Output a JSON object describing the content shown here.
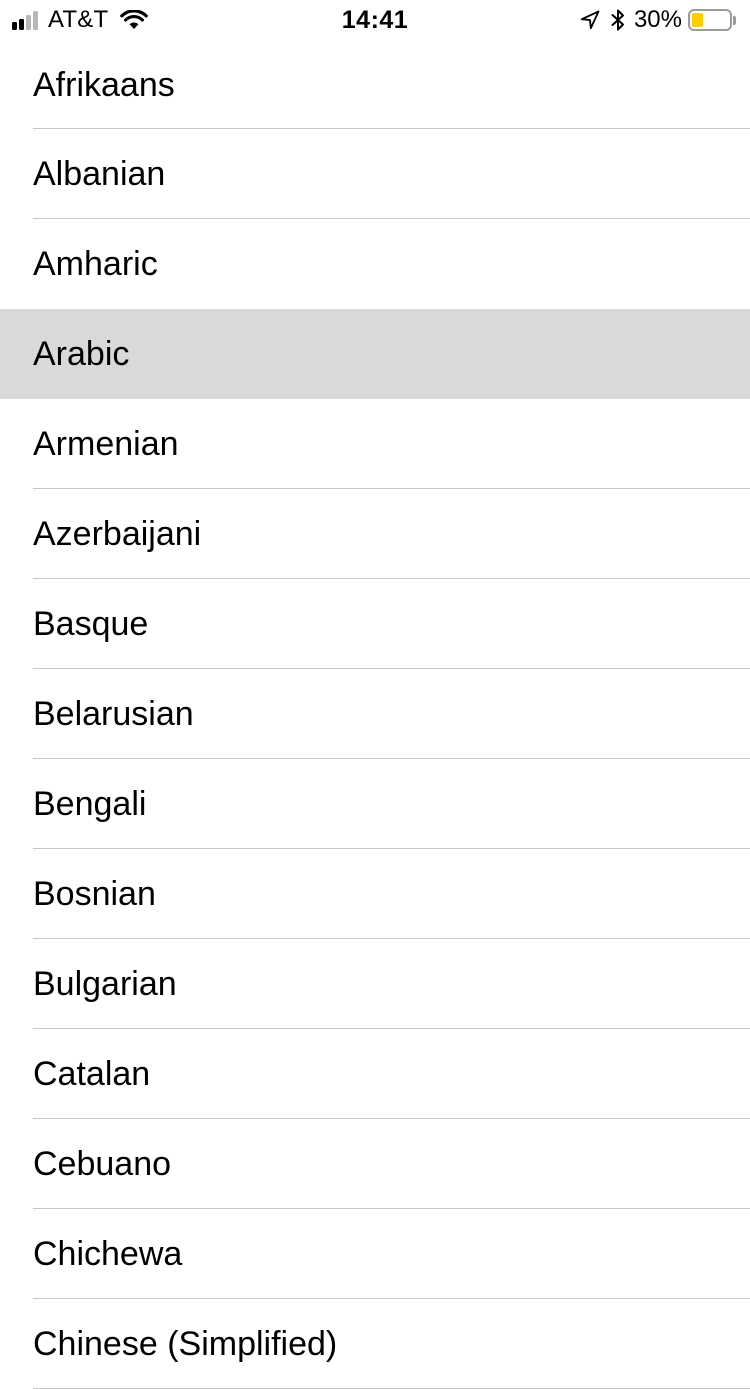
{
  "status_bar": {
    "carrier": "AT&T",
    "time": "14:41",
    "battery_percent": "30%",
    "battery_level": 0.3,
    "battery_color": "#ffcc00",
    "signal_bars_active": 2,
    "signal_bars_total": 4,
    "icons": [
      "signal-icon",
      "wifi-icon",
      "location-arrow-icon",
      "bluetooth-icon",
      "battery-icon"
    ]
  },
  "languages": {
    "items": [
      {
        "label": "Afrikaans"
      },
      {
        "label": "Albanian"
      },
      {
        "label": "Amharic"
      },
      {
        "label": "Arabic",
        "selected": true
      },
      {
        "label": "Armenian"
      },
      {
        "label": "Azerbaijani"
      },
      {
        "label": "Basque"
      },
      {
        "label": "Belarusian"
      },
      {
        "label": "Bengali"
      },
      {
        "label": "Bosnian"
      },
      {
        "label": "Bulgarian"
      },
      {
        "label": "Catalan"
      },
      {
        "label": "Cebuano"
      },
      {
        "label": "Chichewa"
      },
      {
        "label": "Chinese (Simplified)"
      }
    ]
  },
  "colors": {
    "selected_row": "#d9d9d9",
    "separator": "#c8c7cc"
  }
}
